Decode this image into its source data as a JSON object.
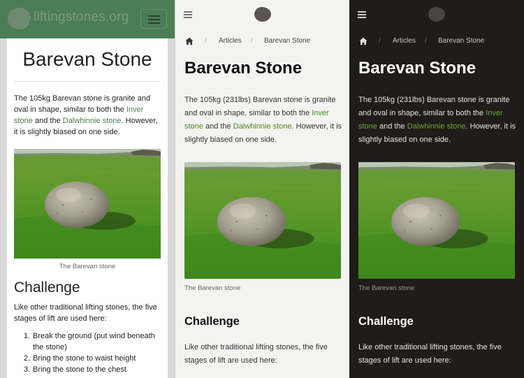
{
  "old_design": {
    "site_name": "liftingstones.org",
    "title": "Barevan Stone",
    "intro": {
      "t1": "The 105kg Barevan stone is granite and oval in shape, similar to both the ",
      "link1": "Inver stone",
      "t2": " and the ",
      "link2": "Dalwhinnie stone",
      "t3": ". However, it is slightly biased on one side."
    },
    "image_caption": "The Barevan stone",
    "challenge_heading": "Challenge",
    "challenge_text": "Like other traditional lifting stones, the five stages of lift are used here:",
    "stages": [
      {
        "num": "1.",
        "text": "Break the ground (put wind beneath the stone)"
      },
      {
        "num": "2.",
        "text": "Bring the stone to waist height"
      },
      {
        "num": "3.",
        "text": "Bring the stone to the chest"
      }
    ],
    "colors": {
      "header_bg": "#4b7d55",
      "link": "#4b7d55"
    }
  },
  "new_design": {
    "breadcrumb": {
      "home_icon": "home-icon",
      "separator": "/",
      "items": [
        "Articles",
        "Barevan Stone"
      ]
    },
    "title": "Barevan Stone",
    "intro": {
      "t1": "The 105kg (231lbs) Barevan stone is granite and oval in shape, similar to both the ",
      "link1": "Inver stone",
      "t2": " and the ",
      "link2": "Dalwhinnie stone",
      "t3": ". However, it is slightly biased on one side."
    },
    "image_caption": "The Barevan stone",
    "challenge_heading": "Challenge",
    "challenge_text": "Like other traditional lifting stones, the five stages of lift are used here:",
    "icons": {
      "menu": "hamburger-menu-icon",
      "logo": "stone-logo-icon"
    },
    "themes": {
      "light": {
        "background": "#f3f3f1",
        "link": "#4c8a1f"
      },
      "dark": {
        "background": "#1f1c19",
        "link": "#6aa82e"
      }
    }
  }
}
